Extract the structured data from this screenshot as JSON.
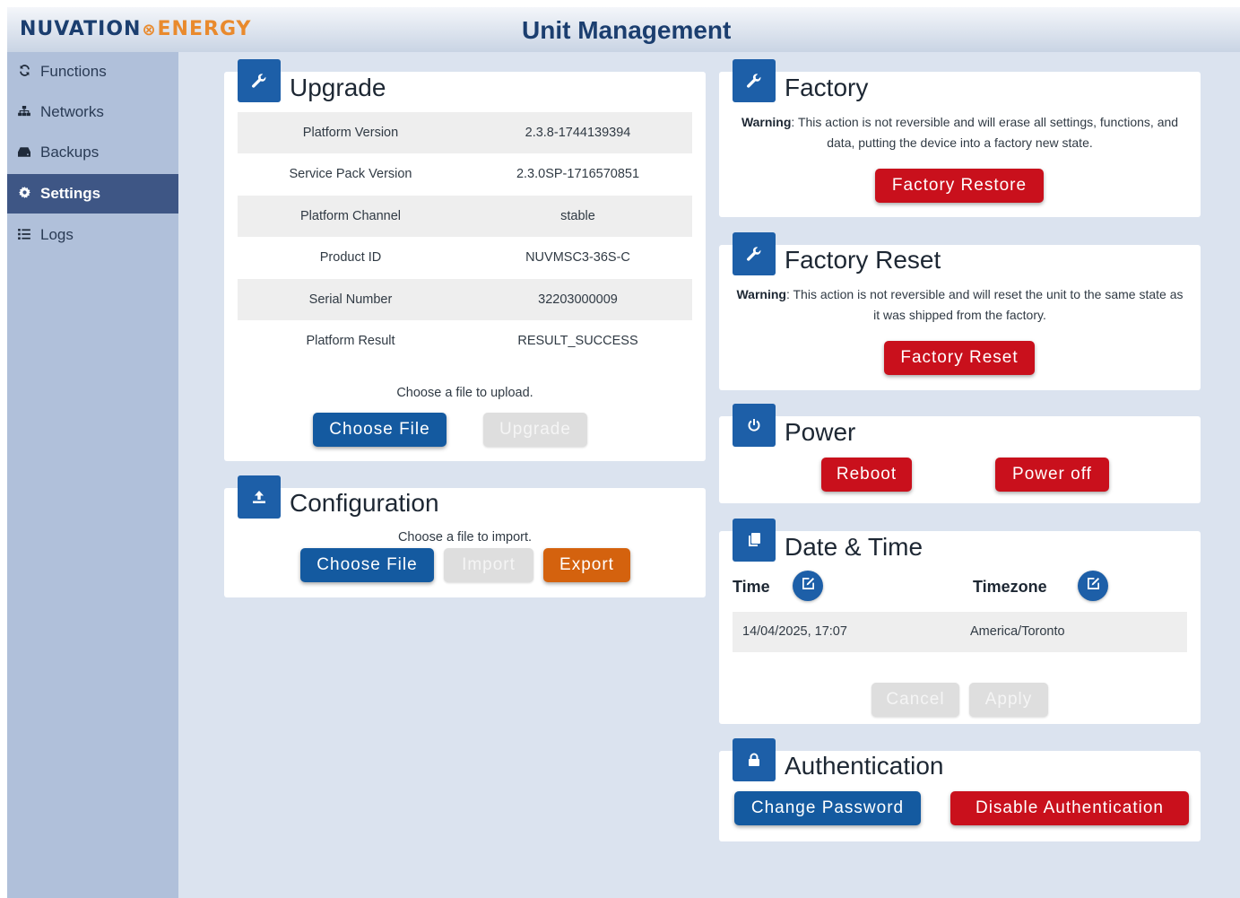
{
  "header": {
    "logo_left": "NUVATION",
    "logo_right": "ENERGY",
    "title": "Unit Management"
  },
  "sidebar": {
    "items": [
      {
        "label": "Functions",
        "icon": "sync-icon"
      },
      {
        "label": "Networks",
        "icon": "network-icon"
      },
      {
        "label": "Backups",
        "icon": "drive-icon"
      },
      {
        "label": "Settings",
        "icon": "gear-icon",
        "active": true
      },
      {
        "label": "Logs",
        "icon": "list-icon"
      }
    ]
  },
  "upgrade": {
    "title": "Upgrade",
    "rows": [
      {
        "label": "Platform Version",
        "value": "2.3.8-1744139394"
      },
      {
        "label": "Service Pack Version",
        "value": "2.3.0SP-1716570851"
      },
      {
        "label": "Platform Channel",
        "value": "stable"
      },
      {
        "label": "Product ID",
        "value": "NUVMSC3-36S-C"
      },
      {
        "label": "Serial Number",
        "value": "32203000009"
      },
      {
        "label": "Platform Result",
        "value": "RESULT_SUCCESS"
      }
    ],
    "upload_prompt": "Choose a file to upload.",
    "choose_file_label": "Choose File",
    "upgrade_label": "Upgrade"
  },
  "configuration": {
    "title": "Configuration",
    "import_prompt": "Choose a file to import.",
    "choose_file_label": "Choose File",
    "import_label": "Import",
    "export_label": "Export"
  },
  "factory": {
    "title": "Factory",
    "warning_label": "Warning",
    "warning_text": ": This action is not reversible and will erase all settings, functions, and data, putting the device into a factory new state.",
    "button_label": "Factory Restore"
  },
  "factory_reset": {
    "title": "Factory Reset",
    "warning_label": "Warning",
    "warning_text": ": This action is not reversible and will reset the unit to the same state as it was shipped from the factory.",
    "button_label": "Factory Reset"
  },
  "power": {
    "title": "Power",
    "reboot_label": "Reboot",
    "poweroff_label": "Power off"
  },
  "datetime": {
    "title": "Date & Time",
    "time_label": "Time",
    "timezone_label": "Timezone",
    "time_value": "14/04/2025, 17:07",
    "timezone_value": "America/Toronto",
    "cancel_label": "Cancel",
    "apply_label": "Apply"
  },
  "authentication": {
    "title": "Authentication",
    "change_password_label": "Change Password",
    "disable_label": "Disable Authentication"
  },
  "colors": {
    "brand_navy": "#1b3e6f",
    "brand_orange": "#e98a2d",
    "primary_blue": "#145aa0",
    "danger_red": "#c9101c",
    "export_orange": "#d4620e",
    "sidebar_bg": "#b0c0da",
    "sidebar_active": "#3e5685"
  }
}
